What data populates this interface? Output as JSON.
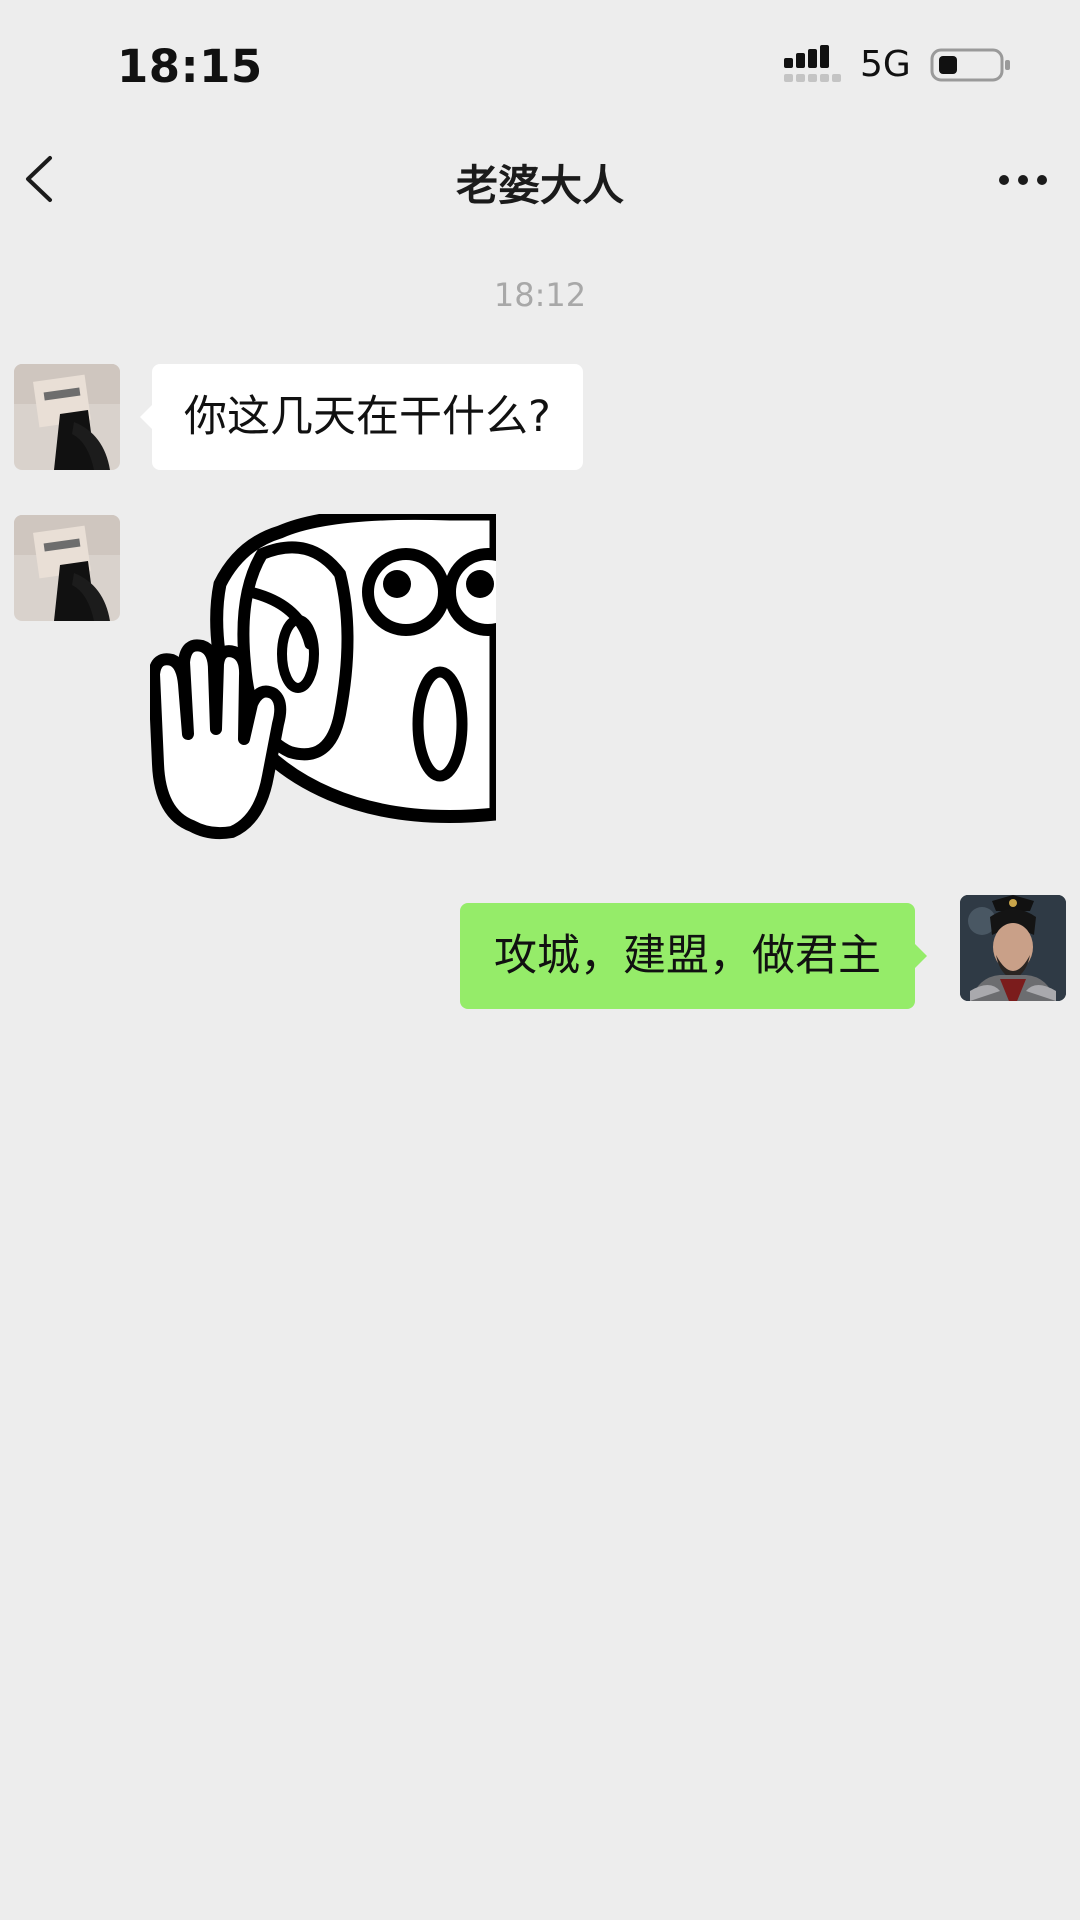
{
  "status_bar": {
    "time": "18:15",
    "network": "5G",
    "icons": [
      "signal-icon",
      "battery-icon"
    ]
  },
  "nav": {
    "title": "老婆大人",
    "icons": [
      "back-arrow-icon",
      "more-options-icon"
    ]
  },
  "chat": {
    "timestamp": "18:12",
    "messages": [
      {
        "side": "left",
        "type": "text",
        "text": "你这几天在干什么?"
      },
      {
        "side": "left",
        "type": "sticker",
        "icon": "peeking-face-sticker"
      },
      {
        "side": "right",
        "type": "text",
        "text": "攻城，建盟，做君主"
      }
    ]
  },
  "colors": {
    "background": "#ededed",
    "incoming_bubble": "#ffffff",
    "outgoing_bubble": "#95ec69",
    "timestamp_text": "#a8a8a8"
  }
}
